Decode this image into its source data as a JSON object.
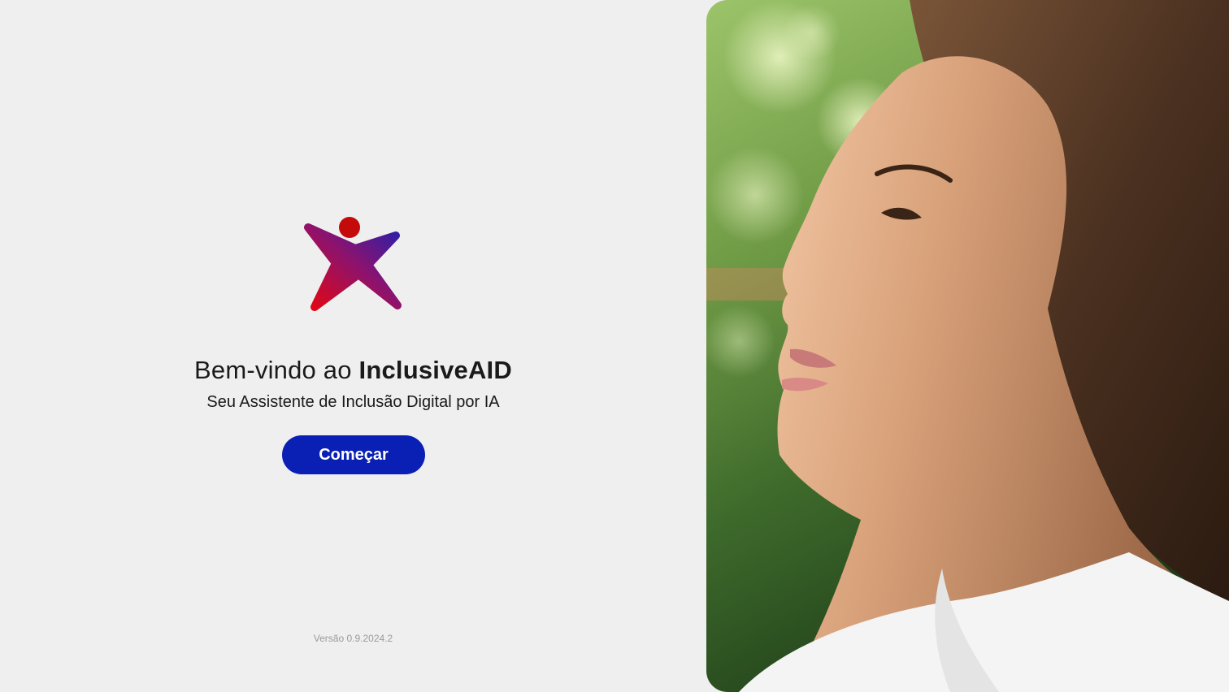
{
  "welcome": {
    "prefix": "Bem-vindo ao ",
    "brand": "InclusiveAID",
    "subtitle": "Seu Assistente de Inclusão Digital por IA"
  },
  "actions": {
    "start_label": "Começar"
  },
  "footer": {
    "version": "Versão 0.9.2024.2"
  },
  "colors": {
    "background": "#efefef",
    "button": "#0a1fb4",
    "logo_gradient_start": "#e30613",
    "logo_gradient_end": "#2a1fa8",
    "logo_head": "#c40a0a"
  },
  "icons": {
    "logo": "inclusiveaid-person-logo"
  }
}
